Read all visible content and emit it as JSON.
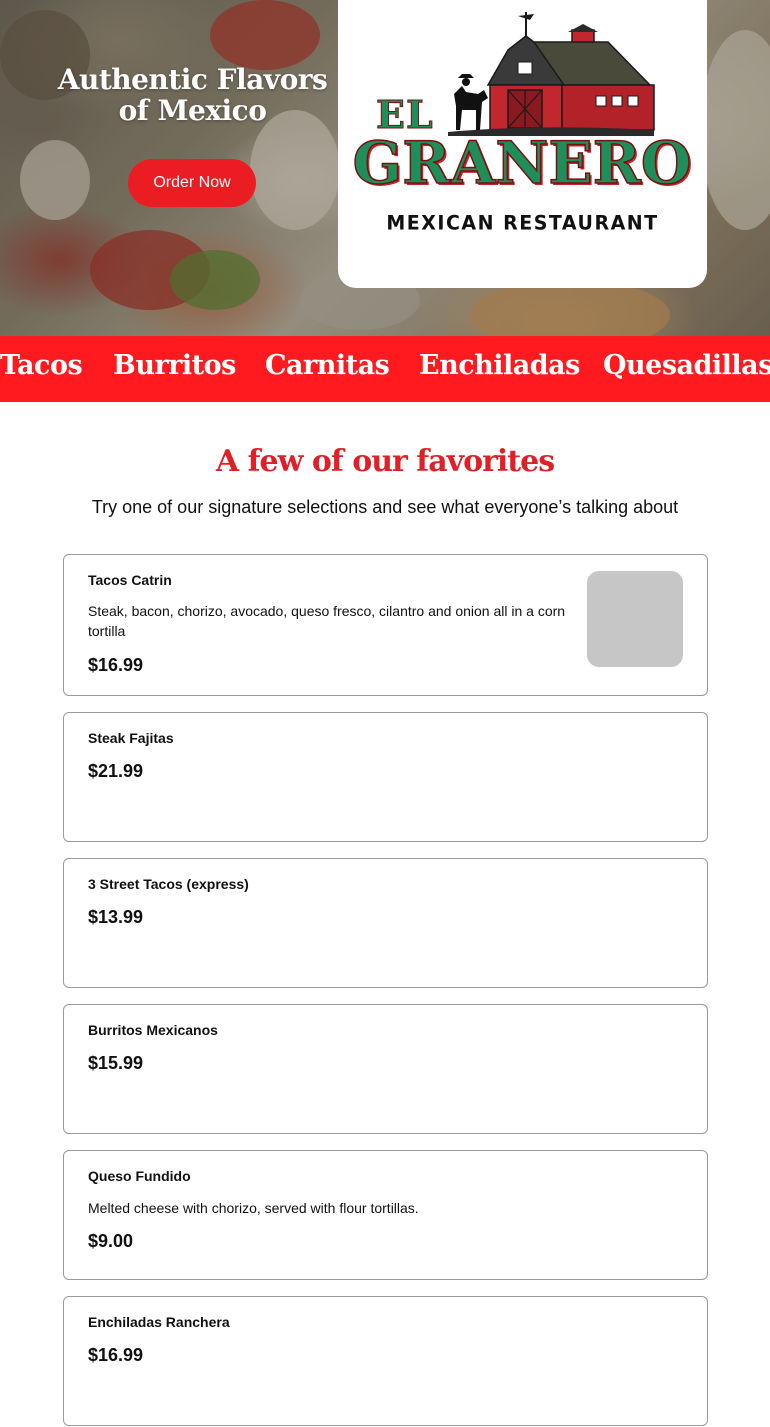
{
  "hero": {
    "headline": "Authentic Flavors of Mexico",
    "order_button": "Order Now"
  },
  "logo": {
    "top_word": "EL",
    "main_word": "GRANERO",
    "subtitle": "MEXICAN RESTAURANT"
  },
  "banner": {
    "items": [
      "Tacos",
      "Burritos",
      "Carnitas",
      "Enchiladas",
      "Quesadillas"
    ]
  },
  "favorites": {
    "title": "A few of our favorites",
    "subtitle": "Try one of our signature selections and see what everyone’s talking about",
    "items": [
      {
        "name": "Tacos Catrin",
        "description": "Steak, bacon, chorizo, avocado, queso fresco, cilantro and onion all in a corn tortilla",
        "price": "$16.99"
      },
      {
        "name": "Steak Fajitas",
        "description": "",
        "price": "$21.99"
      },
      {
        "name": "3 Street Tacos (express)",
        "description": "",
        "price": "$13.99"
      },
      {
        "name": "Burritos Mexicanos",
        "description": "",
        "price": "$15.99"
      },
      {
        "name": "Queso Fundido",
        "description": "Melted cheese with chorizo, served with flour tortillas.",
        "price": "$9.00"
      },
      {
        "name": "Enchiladas Ranchera",
        "description": "",
        "price": "$16.99"
      }
    ]
  },
  "colors": {
    "brand_red": "#ec1c23",
    "logo_green": "#1e8e5a",
    "barn_red": "#c1272d"
  }
}
